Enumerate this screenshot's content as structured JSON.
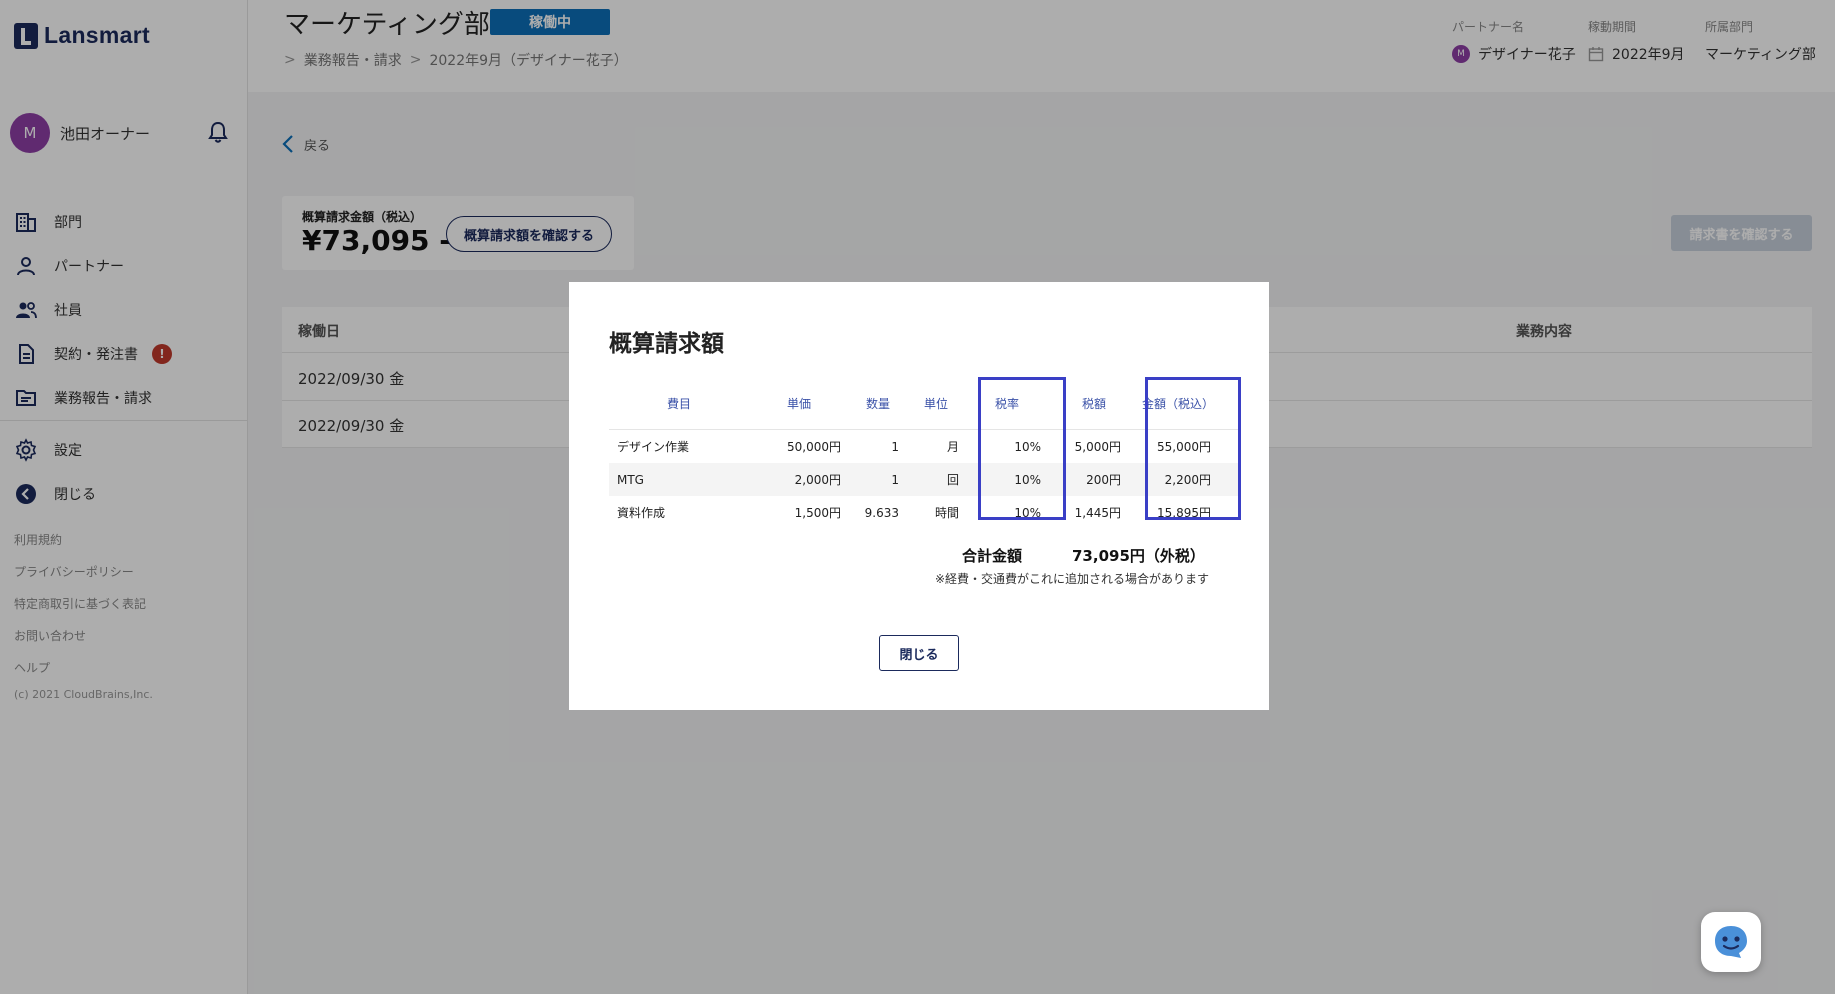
{
  "app": {
    "logo_text": "Lansmart"
  },
  "user": {
    "avatar_initial": "M",
    "name": "池田オーナー"
  },
  "nav": {
    "items": [
      {
        "label": "部門"
      },
      {
        "label": "パートナー"
      },
      {
        "label": "社員"
      },
      {
        "label": "契約・発注書",
        "badge": "!"
      },
      {
        "label": "業務報告・請求"
      }
    ],
    "settings_label": "設定",
    "close_label": "閉じる"
  },
  "footer": {
    "links": [
      "利用規約",
      "プライバシーポリシー",
      "特定商取引に基づく表記",
      "お問い合わせ",
      "ヘルプ"
    ],
    "copyright": "(c) 2021 CloudBrains,Inc."
  },
  "header": {
    "title": "マーケティング部",
    "status": "稼働中",
    "breadcrumb": [
      "業務報告・請求",
      "2022年9月（デザイナー花子）"
    ],
    "meta": {
      "partner_label": "パートナー名",
      "partner_initial": "M",
      "partner_value": "デザイナー花子",
      "period_label": "稼動期間",
      "period_value": "2022年9月",
      "dept_label": "所属部門",
      "dept_value": "マーケティング部"
    }
  },
  "main": {
    "back_label": "戻る",
    "estimate_label": "概算請求金額（税込）",
    "estimate_amount": "¥73,095 -",
    "estimate_button": "概算請求額を確認する",
    "invoice_button": "請求書を確認する",
    "table": {
      "col_date": "稼働日",
      "col_content": "業務内容",
      "rows": [
        "2022/09/30 金",
        "2022/09/30 金"
      ]
    }
  },
  "modal": {
    "title": "概算請求額",
    "headers": {
      "item": "費目",
      "unit_price": "単価",
      "qty": "数量",
      "unit": "単位",
      "tax_rate": "税率",
      "tax": "税額",
      "amount": "金額（税込）"
    },
    "rows": [
      {
        "item": "デザイン作業",
        "unit_price": "50,000円",
        "qty": "1",
        "unit": "月",
        "tax_rate": "10%",
        "tax": "5,000円",
        "amount": "55,000円"
      },
      {
        "item": "MTG",
        "unit_price": "2,000円",
        "qty": "1",
        "unit": "回",
        "tax_rate": "10%",
        "tax": "200円",
        "amount": "2,200円"
      },
      {
        "item": "資料作成",
        "unit_price": "1,500円",
        "qty": "9.633",
        "unit": "時間",
        "tax_rate": "10%",
        "tax": "1,445円",
        "amount": "15,895円"
      }
    ],
    "total_label": "合計金額",
    "total_value": "73,095円（外税）",
    "note": "※経費・交通費がこれに追加される場合があります",
    "close_button": "閉じる"
  },
  "colors": {
    "brand": "#1b2a5c",
    "status": "#0d6fb8",
    "highlight": "#3a3fc6",
    "alert": "#c0392b"
  }
}
